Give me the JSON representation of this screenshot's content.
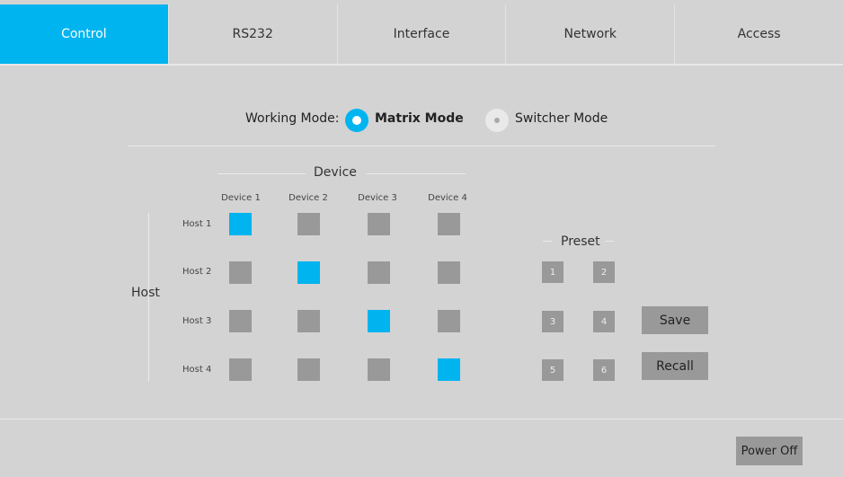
{
  "tabs": [
    "Control",
    "RS232",
    "Interface",
    "Network",
    "Access"
  ],
  "active_tab": "Control",
  "working_mode": {
    "label": "Working Mode:",
    "options": [
      "Matrix Mode",
      "Switcher Mode"
    ],
    "selected": "Matrix Mode"
  },
  "matrix": {
    "device_title": "Device",
    "host_title": "Host",
    "devices": [
      "Device 1",
      "Device 2",
      "Device 3",
      "Device 4"
    ],
    "hosts": [
      "Host 1",
      "Host 2",
      "Host 3",
      "Host 4"
    ],
    "routes": [
      {
        "host": "Host 1",
        "device": "Device 1"
      },
      {
        "host": "Host 2",
        "device": "Device 2"
      },
      {
        "host": "Host 3",
        "device": "Device 3"
      },
      {
        "host": "Host 4",
        "device": "Device 4"
      }
    ]
  },
  "preset": {
    "title": "Preset",
    "buttons": [
      "1",
      "2",
      "3",
      "4",
      "5",
      "6"
    ],
    "save_label": "Save",
    "recall_label": "Recall"
  },
  "footer": {
    "power_off_label": "Power Off"
  },
  "colors": {
    "accent": "#00b4f0",
    "background": "#d3d3d3",
    "inactive_cell": "#999999"
  }
}
